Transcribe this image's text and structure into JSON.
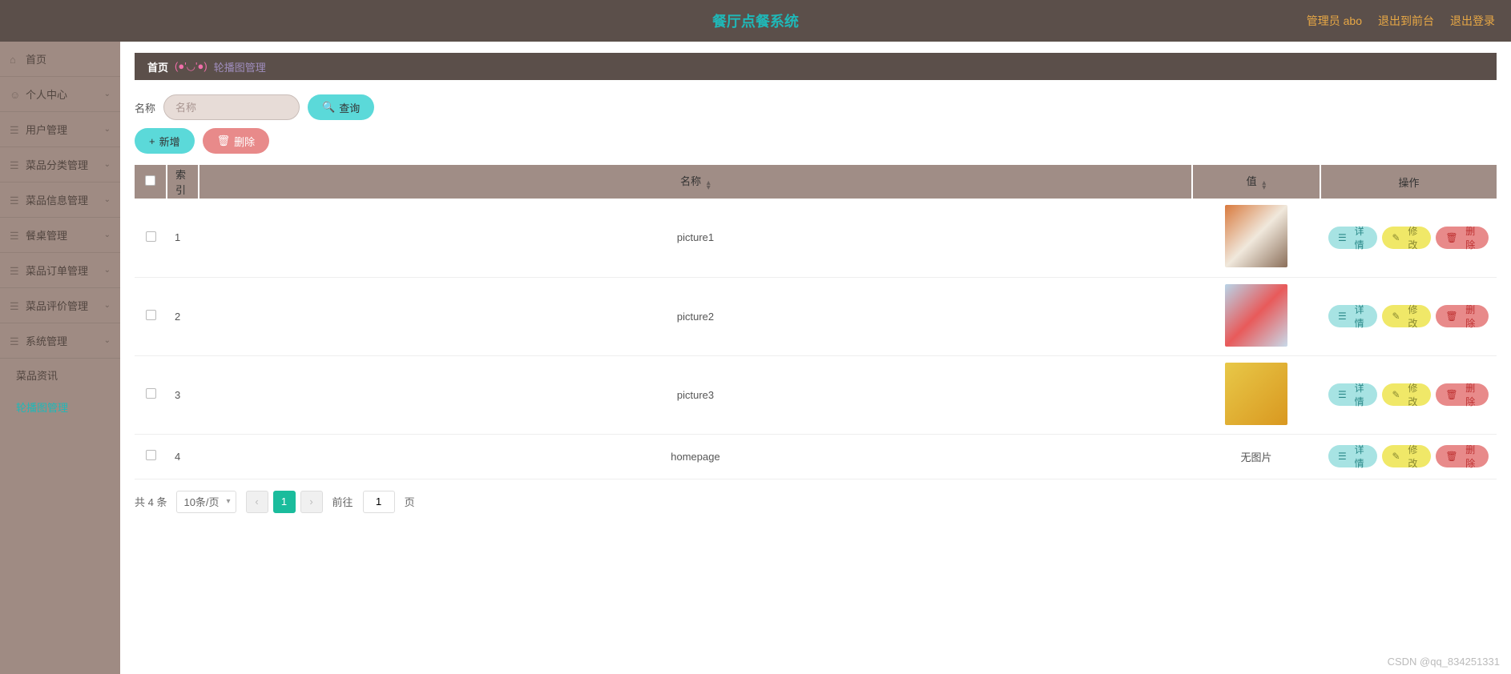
{
  "header": {
    "title": "餐厅点餐系统",
    "admin_label": "管理员 abo",
    "exit_front_label": "退出到前台",
    "logout_label": "退出登录"
  },
  "sidebar": {
    "items": [
      {
        "label": "首页",
        "icon": "home"
      },
      {
        "label": "个人中心",
        "icon": "user",
        "expandable": true
      },
      {
        "label": "用户管理",
        "icon": "users",
        "expandable": true
      },
      {
        "label": "菜品分类管理",
        "icon": "category",
        "expandable": true
      },
      {
        "label": "菜品信息管理",
        "icon": "dish",
        "expandable": true
      },
      {
        "label": "餐桌管理",
        "icon": "table",
        "expandable": true
      },
      {
        "label": "菜品订单管理",
        "icon": "order",
        "expandable": true
      },
      {
        "label": "菜品评价管理",
        "icon": "review",
        "expandable": true
      },
      {
        "label": "系统管理",
        "icon": "system",
        "expandable": true,
        "expanded": true
      }
    ],
    "subitems": [
      {
        "label": "菜品资讯"
      },
      {
        "label": "轮播图管理",
        "active": true
      }
    ]
  },
  "breadcrumb": {
    "home": "首页",
    "separator": "(●'◡'●)",
    "current": "轮播图管理"
  },
  "search": {
    "label": "名称",
    "placeholder": "名称",
    "button": "查询"
  },
  "actions": {
    "add": "新增",
    "delete": "删除"
  },
  "table": {
    "headers": {
      "index": "索引",
      "name": "名称",
      "value": "值",
      "ops": "操作"
    },
    "rows": [
      {
        "index": "1",
        "name": "picture1",
        "value_type": "image",
        "thumb_class": "p1"
      },
      {
        "index": "2",
        "name": "picture2",
        "value_type": "image",
        "thumb_class": "p2"
      },
      {
        "index": "3",
        "name": "picture3",
        "value_type": "image",
        "thumb_class": "p3"
      },
      {
        "index": "4",
        "name": "homepage",
        "value_type": "noimage",
        "noimg_text": "无图片"
      }
    ],
    "row_actions": {
      "detail": "详情",
      "edit": "修改",
      "delete": "删除"
    }
  },
  "pagination": {
    "total_text": "共 4 条",
    "pagesize": "10条/页",
    "current": "1",
    "goto_prefix": "前往",
    "goto_value": "1",
    "goto_suffix": "页"
  },
  "watermark": "CSDN @qq_834251331"
}
